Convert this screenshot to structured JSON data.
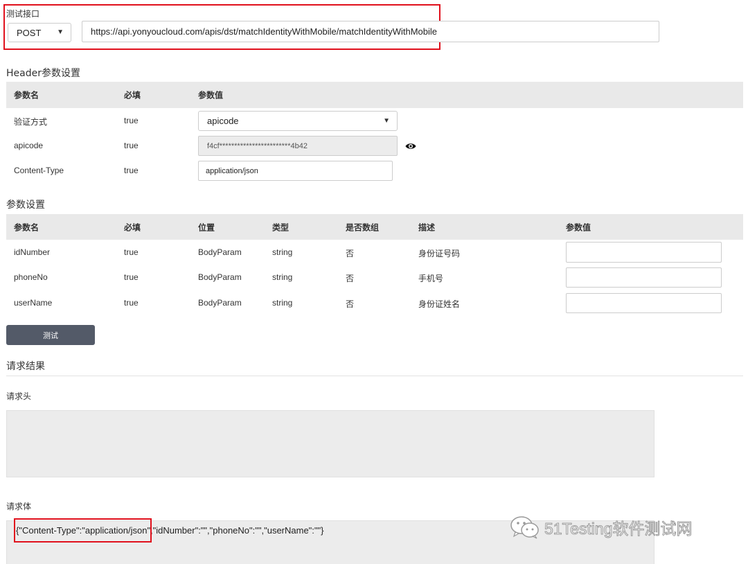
{
  "endpoint": {
    "section_label": "测试接口",
    "method": "POST",
    "url": "https://api.yonyoucloud.com/apis/dst/matchIdentityWithMobile/matchIdentityWithMobile"
  },
  "header_settings": {
    "title": "Header参数设置",
    "columns": [
      "参数名",
      "必填",
      "参数值"
    ],
    "rows": [
      {
        "name": "验证方式",
        "required": "true",
        "value": "apicode"
      },
      {
        "name": "apicode",
        "required": "true",
        "value": "f4cf************************4b42"
      },
      {
        "name": "Content-Type",
        "required": "true",
        "value": "application/json"
      }
    ]
  },
  "param_settings": {
    "title": "参数设置",
    "columns": [
      "参数名",
      "必填",
      "位置",
      "类型",
      "是否数组",
      "描述",
      "参数值"
    ],
    "rows": [
      {
        "name": "idNumber",
        "required": "true",
        "position": "BodyParam",
        "type": "string",
        "is_array": "否",
        "desc": "身份证号码",
        "value": ""
      },
      {
        "name": "phoneNo",
        "required": "true",
        "position": "BodyParam",
        "type": "string",
        "is_array": "否",
        "desc": "手机号",
        "value": ""
      },
      {
        "name": "userName",
        "required": "true",
        "position": "BodyParam",
        "type": "string",
        "is_array": "否",
        "desc": "身份证姓名",
        "value": ""
      }
    ]
  },
  "test_button": {
    "label": "测试"
  },
  "result": {
    "title": "请求结果",
    "request_header_label": "请求头",
    "request_header_text": "",
    "request_body_label": "请求体",
    "request_body_part1": "{\"Content-Type\":\"application/json\"",
    "request_body_part2": ",\"idNumber\":\"\",\"phoneNo\":\"\",\"userName\":\"\"}"
  },
  "watermark": {
    "text": "51Testing软件测试网",
    "icon": "wechat-icon"
  },
  "colors": {
    "highlight_red": "#e0101c",
    "button_bg": "#535a68",
    "table_header_bg": "#e9e9e9"
  }
}
